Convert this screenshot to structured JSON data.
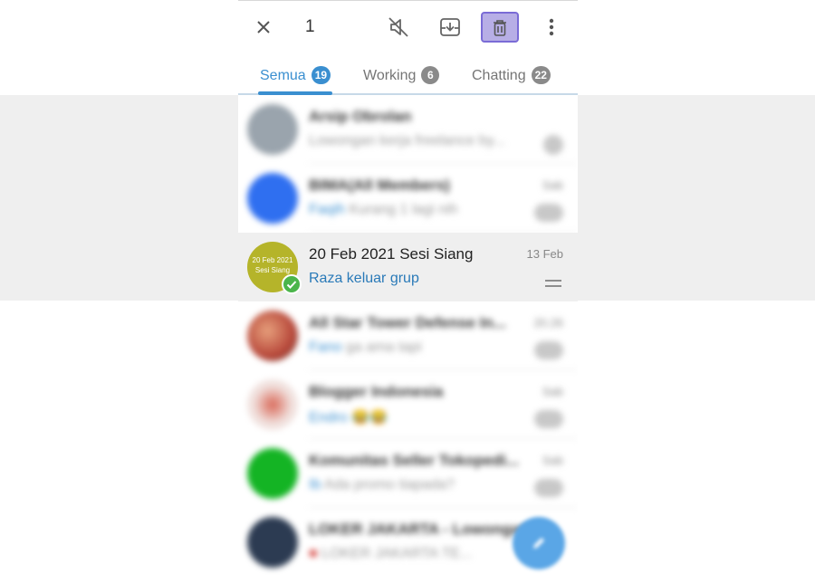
{
  "selection": {
    "count": "1"
  },
  "actions": {
    "close": "close-icon",
    "mute": "mute-icon",
    "archive": "archive-icon",
    "delete": "delete-icon",
    "more": "more-vert-icon"
  },
  "tabs": [
    {
      "label": "Semua",
      "badge": "19",
      "active": true
    },
    {
      "label": "Working",
      "badge": "6",
      "active": false
    },
    {
      "label": "Chatting",
      "badge": "22",
      "active": false
    }
  ],
  "chats": [
    {
      "name": "Arsip Obrolan",
      "message": "Lowongan kerja freelance by...",
      "time": "",
      "avatar_color": "#9aa4ad",
      "blurred": true
    },
    {
      "name": "BIMA(All Members)",
      "sender": "Faqih",
      "message": "Kurang 1 lagi nih",
      "time": "Sab",
      "avatar_color": "#2f6ff0",
      "blurred": true
    },
    {
      "name": "20 Feb 2021 Sesi Siang",
      "avatar_text": "20 Feb 2021\nSesi Siang",
      "message": "Raza keluar grup",
      "time": "13 Feb",
      "avatar_color": "#b5b42a",
      "blurred": false,
      "selected": true
    },
    {
      "name": "All Star Tower Defense In...",
      "sender": "Fano",
      "message": "ga ama tapi",
      "time": "20.26",
      "avatar_color": "#c75b4a",
      "blurred": true
    },
    {
      "name": "Blogger Indonesia",
      "sender": "Endro",
      "message": "😂😂",
      "time": "Sab",
      "avatar_color": "#e9d3cf",
      "blurred": true
    },
    {
      "name": "Komunitas Seller Tokopedi...",
      "sender": "Ib",
      "message": "Ada promo tiapada?",
      "time": "Sab",
      "avatar_color": "#14b424",
      "blurred": true
    },
    {
      "name": "LOKER JAKARTA - Lowongan...",
      "sender": "",
      "message": "LOKER JAKARTA TE...",
      "time": "",
      "avatar_color": "#2c3b52",
      "blurred": true
    }
  ],
  "fab": {
    "icon": "pencil-icon"
  },
  "colors": {
    "accent": "#3a8fd0",
    "selected_bg": "#efefef",
    "check": "#4bb54b"
  }
}
